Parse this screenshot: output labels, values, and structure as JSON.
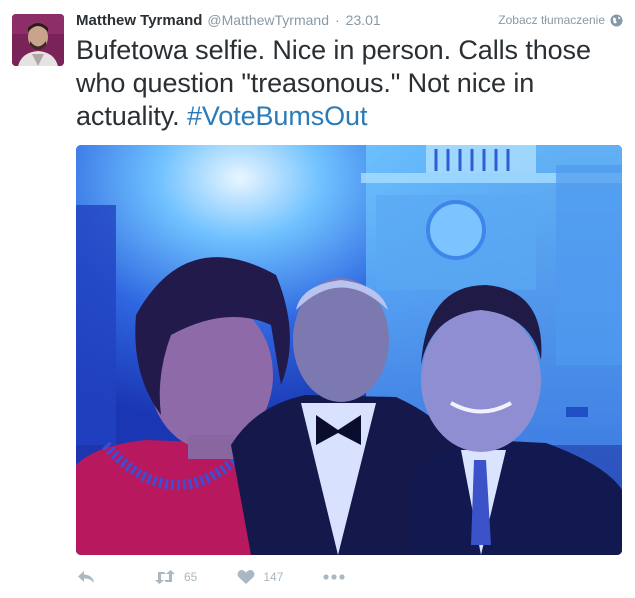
{
  "author": {
    "name": "Matthew Tyrmand",
    "handle": "@MatthewTyrmand",
    "separator": "·",
    "time": "23.01"
  },
  "translate_label": "Zobacz tłumaczenie",
  "tweet": {
    "text": "Bufetowa selfie. Nice in person. Calls those who question \"treasonous.\" Not nice in actuality. ",
    "hashtag": "#VoteBumsOut"
  },
  "actions": {
    "retweet_count": "65",
    "like_count": "147"
  },
  "colors": {
    "hashtag": "#2b7bb9",
    "muted": "#8899a6",
    "icon": "#aab8c2"
  }
}
